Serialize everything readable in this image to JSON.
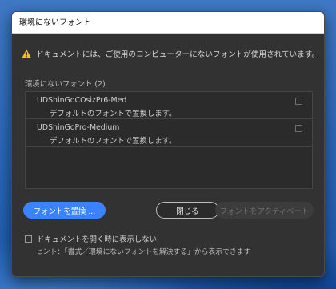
{
  "dialog": {
    "title": "環境にないフォント",
    "warning_message": "ドキュメントには、ご使用のコンピューターにないフォントが使用されています。",
    "section_label": "環境にないフォント (2)",
    "fonts": [
      {
        "name": "UDShinGoCOsizPr6-Med",
        "description": "デフォルトのフォントで置換します。",
        "checked": false
      },
      {
        "name": "UDShinGoPro-Medium",
        "description": "デフォルトのフォントで置換します。",
        "checked": false
      }
    ],
    "buttons": {
      "replace": "フォントを置換 ...",
      "close": "閉じる",
      "activate": "フォントをアクティベート"
    },
    "checkbox_label": "ドキュメントを開く時に表示しない",
    "checkbox_checked": false,
    "hint": "ヒント：「書式／環境にないフォントを解決する」から表示できます"
  },
  "icons": {
    "warning": "warning-triangle-icon"
  },
  "colors": {
    "accent": "#3b82ff",
    "warning": "#f5c20b",
    "dialog_bg": "#323232",
    "desktop": "#2a66b8"
  }
}
